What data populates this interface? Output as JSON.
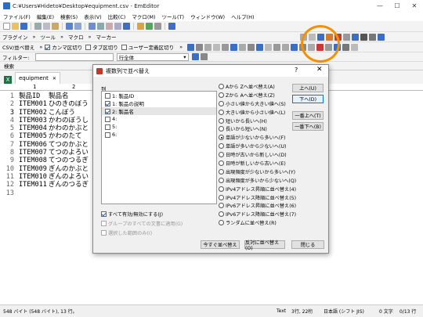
{
  "window": {
    "title": "C:¥Users¥Hideto¥Desktop¥equipment.csv - EmEditor"
  },
  "menu": [
    "ファイル(F)",
    "編集(E)",
    "検索(S)",
    "表示(V)",
    "比較(C)",
    "マクロ(M)",
    "ツール(T)",
    "ウィンドウ(W)",
    "ヘルプ(H)"
  ],
  "toolbar2": [
    "プラグイン",
    "ツール",
    "マクロ",
    "マーカー"
  ],
  "toolbar3": {
    "csv_sort": "CSV/並べ替え",
    "comma": "カンマ区切り",
    "tab": "タブ区切り",
    "user": "ユーザー定義区切り"
  },
  "toolbar4": {
    "filter_label": "フィルター:",
    "scope": "行全体"
  },
  "search_label": "検索",
  "tab": {
    "label": "equipment"
  },
  "ruler": {
    "c1": "1",
    "c2": "2"
  },
  "rows": [
    {
      "n": "1",
      "c1": "製品ID",
      "c2": "製品名"
    },
    {
      "n": "2",
      "c1": "ITEM001",
      "c2": "ひのきのぼう"
    },
    {
      "n": "3",
      "c1": "ITEM002",
      "c2": "こんぼう"
    },
    {
      "n": "4",
      "c1": "ITEM003",
      "c2": "かわのぼうし"
    },
    {
      "n": "5",
      "c1": "ITEM004",
      "c2": "かわのかぶと"
    },
    {
      "n": "6",
      "c1": "ITEM005",
      "c2": "かわのたて"
    },
    {
      "n": "7",
      "c1": "ITEM006",
      "c2": "てつのかぶと"
    },
    {
      "n": "8",
      "c1": "ITEM007",
      "c2": "てつのよろい"
    },
    {
      "n": "9",
      "c1": "ITEM008",
      "c2": "てつのつるぎ"
    },
    {
      "n": "10",
      "c1": "ITEM009",
      "c2": "ぎんのかぶと"
    },
    {
      "n": "11",
      "c1": "ITEM010",
      "c2": "ぎんのよろい"
    },
    {
      "n": "12",
      "c1": "ITEM011",
      "c2": "ぎんのつるぎ"
    },
    {
      "n": "13",
      "c1": "",
      "c2": ""
    }
  ],
  "dialog": {
    "title": "複数列で並べ替え",
    "column_label": "列",
    "columns": [
      {
        "label": "1: 製品ID",
        "checked": false
      },
      {
        "label": "1: 製品の説明",
        "checked": true
      },
      {
        "label": "2: 製品名",
        "checked": true
      },
      {
        "label": "4:",
        "checked": false
      },
      {
        "label": "5:",
        "checked": false
      },
      {
        "label": "6:",
        "checked": false
      }
    ],
    "sort_options": [
      "Aから Zへ並べ替え(A)",
      "Zから Aへ並べ替え(Z)",
      "小さい値から大きい値へ(S)",
      "大きい値から小さい値へ(L)",
      "短いから長いへ(H)",
      "長いから短いへ(N)",
      "単語が少ないから多いへ(F)",
      "単語が多いから少ないへ(U)",
      "日時が古いから新しいへ(D)",
      "日時が新しいから古いへ(E)",
      "出現頻度が少ないから多いへ(Y)",
      "出現頻度が多いから少ないへ(Q)",
      "IPv4アドレス昇順に並べ替え(4)",
      "IPv4アドレス降順に並べ替え(5)",
      "IPv6アドレス昇順に並べ替え(6)",
      "IPv6アドレス降順に並べ替え(7)",
      "ランダムに並べ替え(R)"
    ],
    "selected_option": 6,
    "buttons": {
      "up": "上へ(U)",
      "down": "下へ(D)",
      "top": "一番上へ(T)",
      "bottom": "一番下へ(B)",
      "sort_now": "今すぐ並べ替え",
      "reverse": "反対に並べ替え(O)",
      "close": "閉じる"
    },
    "chk_all": "すべて有効/無効にする(J)",
    "chk_group": "グループのすべての文書に適用(G)",
    "chk_selection": "選択した範囲のみ(I)"
  },
  "status": {
    "left": "548 バイト (548 バイト), 13 行。",
    "mode": "Text",
    "pos": "3行, 22桁",
    "encoding": "日本語 (シフト JIS)",
    "chars": "0 文字",
    "lines": "0/13 行"
  }
}
